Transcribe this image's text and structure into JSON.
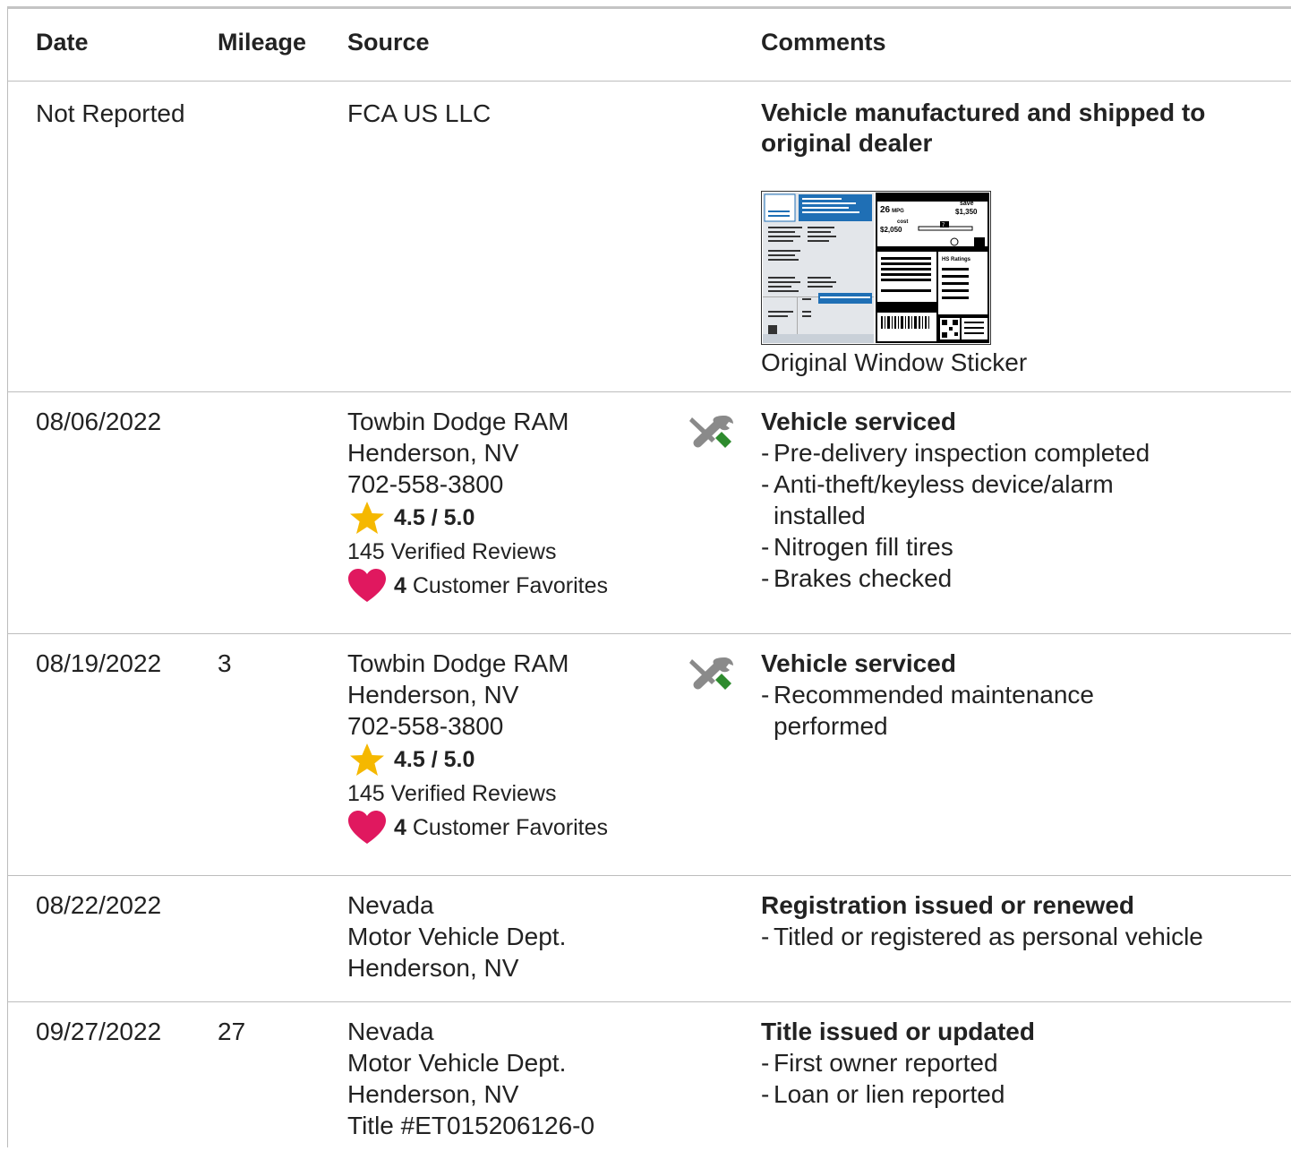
{
  "columns": {
    "date": "Date",
    "mileage": "Mileage",
    "source": "Source",
    "comments": "Comments"
  },
  "rows": [
    {
      "date": "Not Reported",
      "mileage": "",
      "source": [
        "FCA US LLC"
      ],
      "comment_title": "Vehicle manufactured and shipped to original dealer",
      "bullets": [],
      "sticker": {
        "label": "Original Window Sticker",
        "mpg": "26",
        "mpg_unit": "MPG",
        "save_label": "save",
        "save_amount": "$1,350",
        "cost_label": "cost",
        "cost_amount": "$2,050",
        "slider_value": "7",
        "ratings_label": "HS Ratings"
      }
    },
    {
      "date": "08/06/2022",
      "mileage": "",
      "source": [
        "Towbin Dodge RAM",
        "Henderson, NV",
        "702-558-3800"
      ],
      "rating": "4.5 / 5.0",
      "reviews": "145 Verified Reviews",
      "favorites_count": "4",
      "favorites_label": "Customer Favorites",
      "icon": "service-tools-icon",
      "comment_title": "Vehicle serviced",
      "bullets": [
        "Pre-delivery inspection completed",
        "Anti-theft/keyless device/alarm installed",
        "Nitrogen fill tires",
        "Brakes checked"
      ]
    },
    {
      "date": "08/19/2022",
      "mileage": "3",
      "source": [
        "Towbin Dodge RAM",
        "Henderson, NV",
        "702-558-3800"
      ],
      "rating": "4.5 / 5.0",
      "reviews": "145 Verified Reviews",
      "favorites_count": "4",
      "favorites_label": "Customer Favorites",
      "icon": "service-tools-icon",
      "comment_title": "Vehicle serviced",
      "bullets": [
        "Recommended maintenance performed"
      ]
    },
    {
      "date": "08/22/2022",
      "mileage": "",
      "source": [
        "Nevada",
        "Motor Vehicle Dept.",
        "Henderson, NV"
      ],
      "comment_title": "Registration issued or renewed",
      "bullets": [
        "Titled or registered as personal vehicle"
      ]
    },
    {
      "date": "09/27/2022",
      "mileage": "27",
      "source": [
        "Nevada",
        "Motor Vehicle Dept.",
        "Henderson, NV",
        "Title #ET015206126-0"
      ],
      "comment_title": "Title issued or updated",
      "bullets": [
        "First owner reported",
        "Loan or lien reported"
      ]
    }
  ],
  "colors": {
    "star": "#f5b800",
    "heart": "#e0185f",
    "tool_grey": "#8a8a8a",
    "tool_green": "#2e8b2e",
    "sticker_blue": "#1f6fb5",
    "divider": "#bdbdbd"
  }
}
